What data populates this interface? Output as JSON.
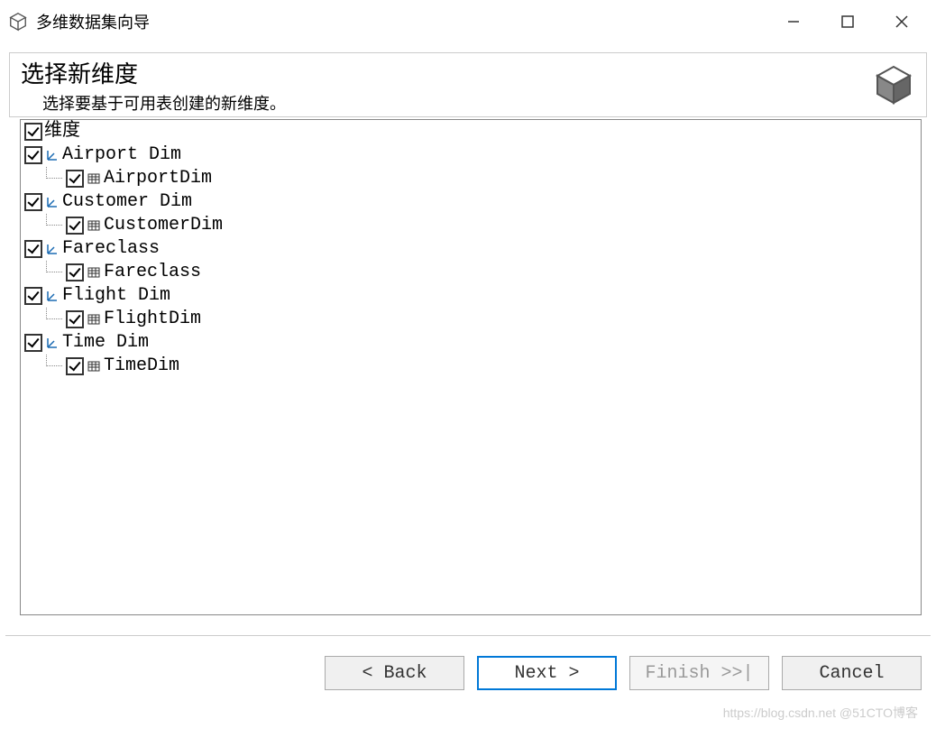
{
  "window": {
    "title": "多维数据集向导"
  },
  "header": {
    "title": "选择新维度",
    "subtitle": "选择要基于可用表创建的新维度。"
  },
  "tree": {
    "root_label": "维度",
    "items": [
      {
        "label": "Airport Dim",
        "child": "AirportDim"
      },
      {
        "label": "Customer Dim",
        "child": "CustomerDim"
      },
      {
        "label": "Fareclass",
        "child": "Fareclass"
      },
      {
        "label": "Flight Dim",
        "child": "FlightDim"
      },
      {
        "label": "Time Dim",
        "child": "TimeDim"
      }
    ]
  },
  "buttons": {
    "back": "< Back",
    "next": "Next >",
    "finish": "Finish >>|",
    "cancel": "Cancel"
  },
  "watermark": "https://blog.csdn.net @51CTO博客"
}
